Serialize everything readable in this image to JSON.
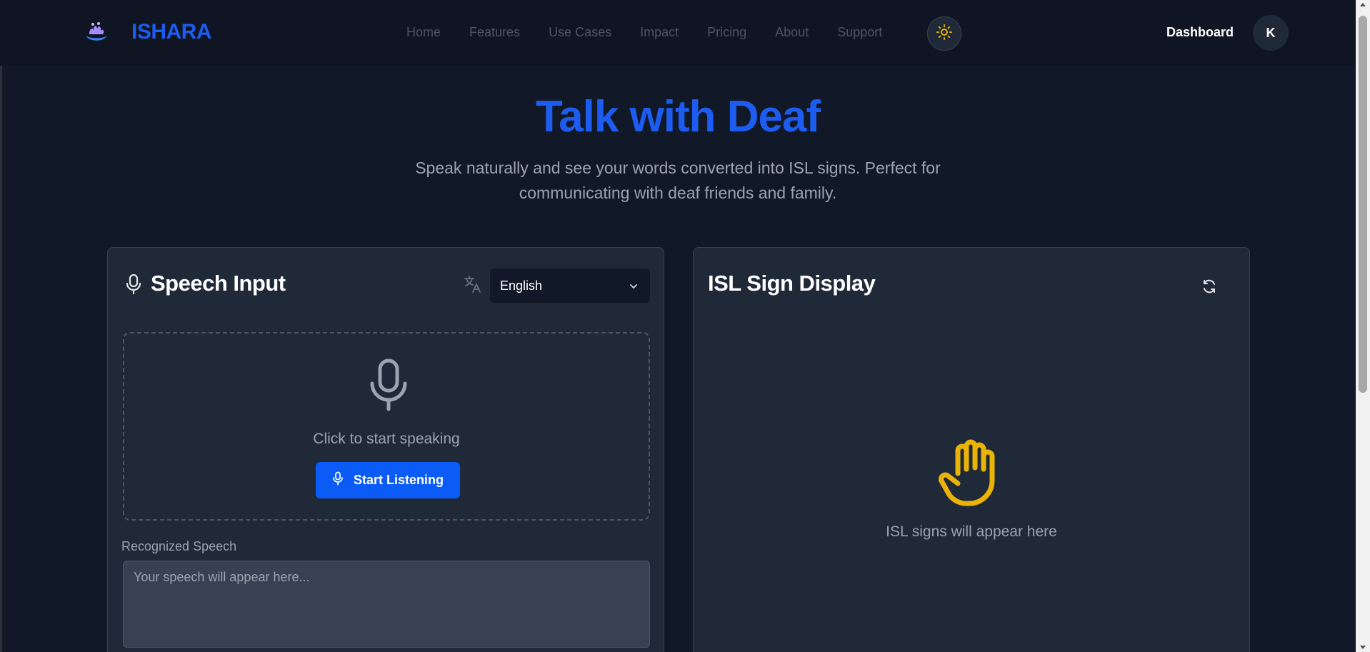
{
  "brand": {
    "name": "ISHARA"
  },
  "nav": {
    "items": [
      {
        "label": "Home"
      },
      {
        "label": "Features"
      },
      {
        "label": "Use Cases"
      },
      {
        "label": "Impact"
      },
      {
        "label": "Pricing"
      },
      {
        "label": "About"
      },
      {
        "label": "Support"
      }
    ],
    "dashboard_label": "Dashboard",
    "avatar_initial": "K",
    "theme_icon": "sun-icon"
  },
  "hero": {
    "title": "Talk with Deaf",
    "subtitle": "Speak naturally and see your words converted into ISL signs. Perfect for communicating with deaf friends and family."
  },
  "speech_panel": {
    "title": "Speech Input",
    "language": "English",
    "prompt": "Click to start speaking",
    "button_label": "Start Listening",
    "recognized_label": "Recognized Speech",
    "recognized_placeholder": "Your speech will appear here..."
  },
  "sign_panel": {
    "title": "ISL Sign Display",
    "placeholder": "ISL signs will appear here"
  },
  "colors": {
    "accent": "#1d5cf0",
    "button": "#0b5cf7",
    "background": "#111827",
    "panel": "#1f2937",
    "hand": "#eab308"
  }
}
